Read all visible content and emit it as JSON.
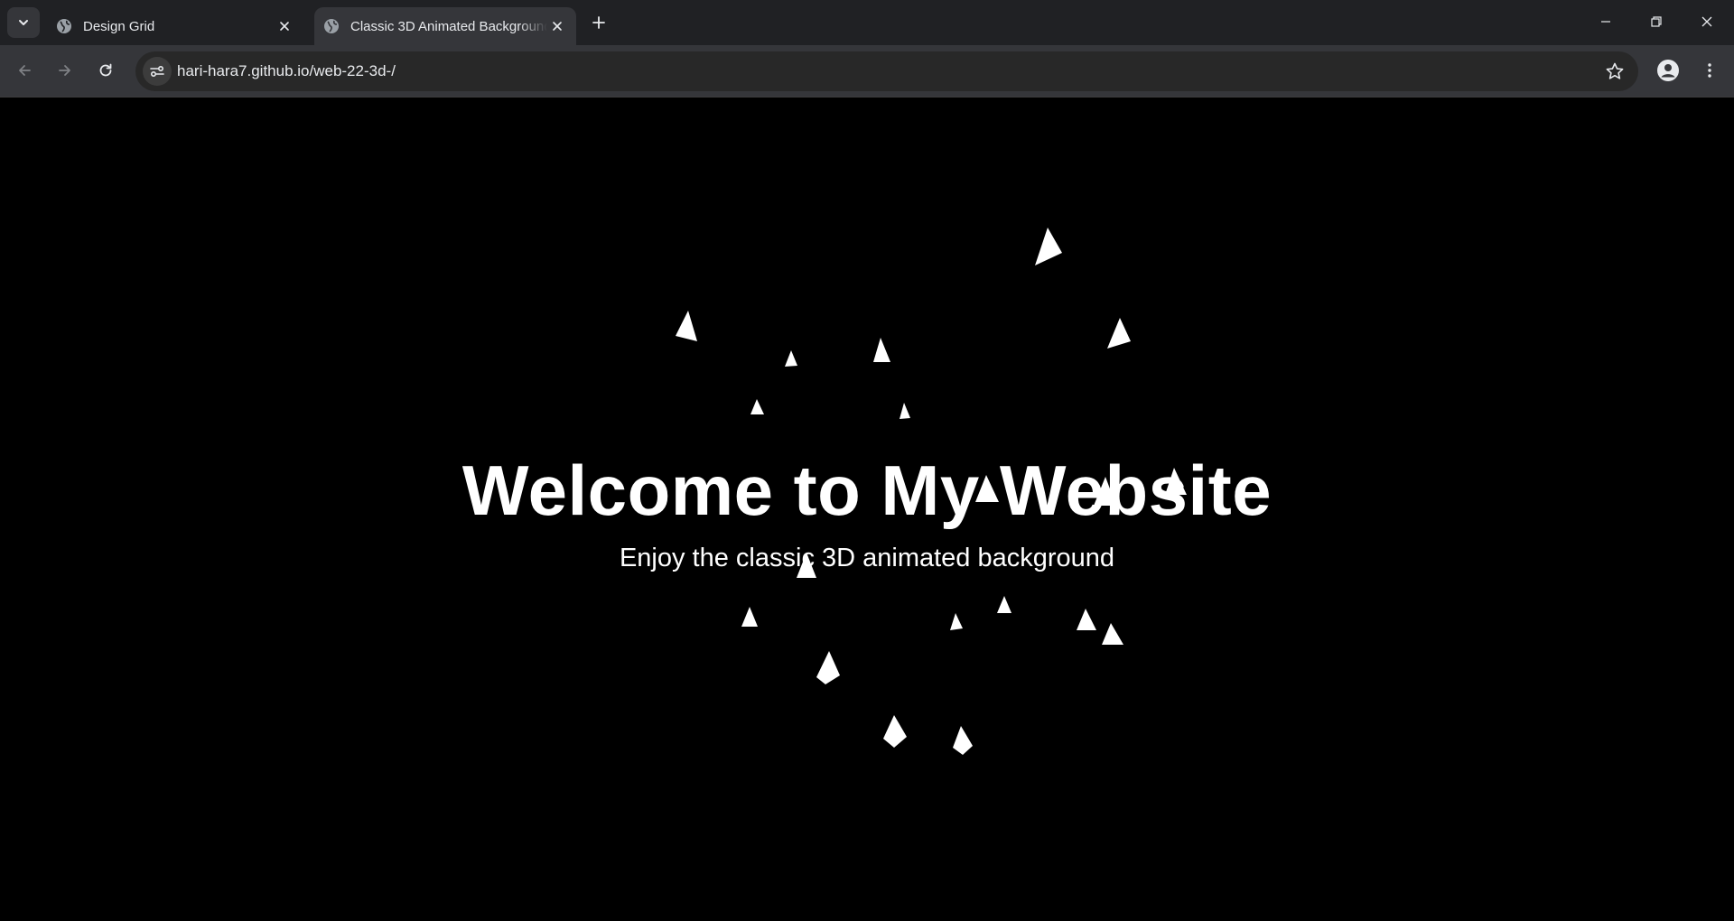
{
  "browser": {
    "tabs": [
      {
        "title": "Design Grid",
        "active": false
      },
      {
        "title": "Classic 3D Animated Background",
        "active": true
      }
    ],
    "url": "hari-hara7.github.io/web-22-3d-/"
  },
  "page": {
    "heading": "Welcome to My Website",
    "subheading": "Enjoy the classic 3D animated background"
  },
  "colors": {
    "page_background": "#000000",
    "shape_color": "#ffffff",
    "chrome_dark": "#202124",
    "chrome_toolbar": "#35363a"
  },
  "icons": {
    "tab_search": "chevron-down-icon",
    "favicon": "globe-icon",
    "tab_close": "close-icon",
    "new_tab": "plus-icon",
    "back": "arrow-left-icon",
    "forward": "arrow-right-icon",
    "reload": "reload-icon",
    "site_info": "tune-icon",
    "bookmark": "star-icon",
    "profile": "person-icon",
    "menu": "more-vertical-icon"
  }
}
